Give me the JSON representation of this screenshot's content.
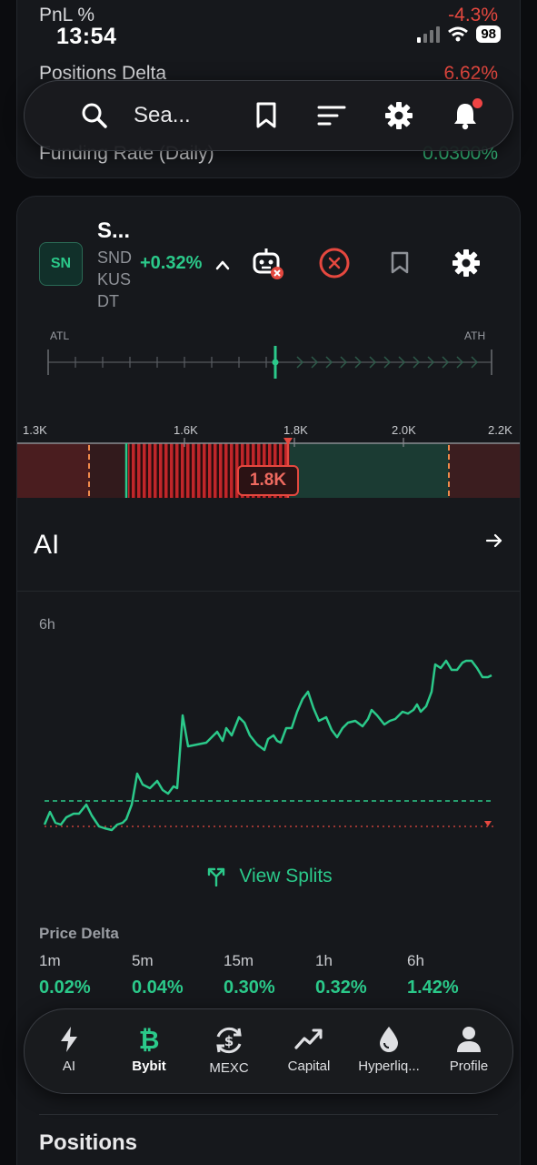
{
  "status": {
    "time": "13:54",
    "battery": "98"
  },
  "top_card": {
    "rows": [
      {
        "label": "PnL %",
        "value": "-4.3%"
      },
      {
        "label": "Positions Delta",
        "value": "6.62%"
      },
      {
        "label": "Funding Rate (Daily)",
        "value": "0.0300%"
      }
    ]
  },
  "search": {
    "placeholder": "Sea..."
  },
  "ticker": {
    "badge": "SN",
    "title": "S...",
    "symbol_lines": [
      "SND",
      "KUS",
      "DT"
    ],
    "change": "+0.32%"
  },
  "range": {
    "low_label": "ATL",
    "high_label": "ATH",
    "axis": [
      "1.3K",
      "1.6K",
      "1.8K",
      "2.0K",
      "2.2K"
    ],
    "current_price": "1.8K"
  },
  "ai": {
    "title": "AI",
    "timeframe": "6h",
    "view_splits": "View Splits"
  },
  "price_delta": {
    "title": "Price Delta",
    "intervals": [
      {
        "label": "1m",
        "value": "0.02%"
      },
      {
        "label": "5m",
        "value": "0.04%"
      },
      {
        "label": "15m",
        "value": "0.30%"
      },
      {
        "label": "1h",
        "value": "0.32%"
      },
      {
        "label": "6h",
        "value": "1.42%"
      }
    ]
  },
  "positions_label": "Positions",
  "tabs": [
    {
      "label": "AI",
      "icon": "bolt-icon"
    },
    {
      "label": "Bybit",
      "icon": "bitcoin-icon"
    },
    {
      "label": "MEXC",
      "icon": "dollar-cycle-icon"
    },
    {
      "label": "Capital",
      "icon": "trend-icon"
    },
    {
      "label": "Hyperliq...",
      "icon": "drop-icon"
    },
    {
      "label": "Profile",
      "icon": "person-icon"
    }
  ],
  "colors": {
    "green": "#2bc98a",
    "red": "#e5483f",
    "background": "#0b0c0f",
    "card": "#16181c"
  }
}
